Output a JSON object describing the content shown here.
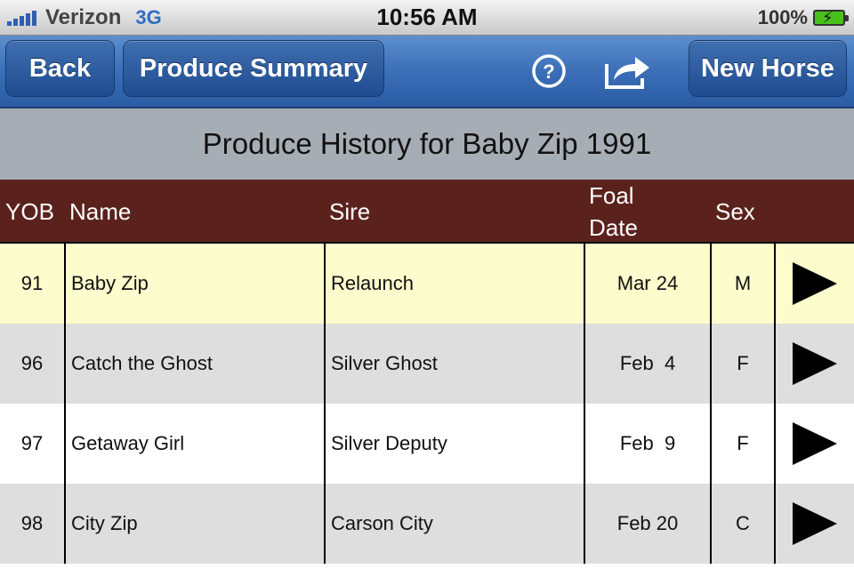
{
  "status_bar": {
    "carrier": "Verizon",
    "network": "3G",
    "time": "10:56 AM",
    "battery": "100%"
  },
  "nav": {
    "back_label": "Back",
    "produce_summary_label": "Produce Summary",
    "new_horse_label": "New Horse",
    "help_icon": "help-circle-icon",
    "share_icon": "share-arrow-icon"
  },
  "title": "Produce History for Baby Zip 1991",
  "columns": {
    "yob": "YOB",
    "name": "Name",
    "sire": "Sire",
    "foal_date": "Foal Date",
    "sex": "Sex"
  },
  "rows": [
    {
      "yob": "91",
      "name": "Baby Zip",
      "sire": "Relaunch",
      "foal_date": "Mar 24",
      "sex": "M",
      "bg": "#fdfccd"
    },
    {
      "yob": "96",
      "name": "Catch the Ghost",
      "sire": "Silver Ghost",
      "foal_date": "Feb  4",
      "sex": "F",
      "bg": "#dedede"
    },
    {
      "yob": "97",
      "name": "Getaway Girl",
      "sire": "Silver Deputy",
      "foal_date": "Feb  9",
      "sex": "F",
      "bg": "#ffffff"
    },
    {
      "yob": "98",
      "name": "City Zip",
      "sire": "Carson City",
      "foal_date": "Feb 20",
      "sex": "C",
      "bg": "#dedede"
    }
  ],
  "colors": {
    "nav_blue": "#3b6fb7",
    "header_maroon": "#5b221d",
    "title_gray": "#a7adb4",
    "highlight_yellow": "#fdfccd"
  }
}
